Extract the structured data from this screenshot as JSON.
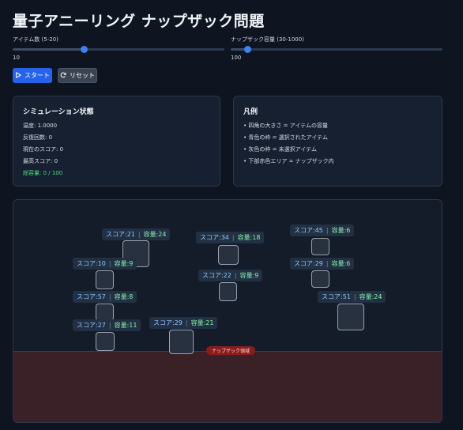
{
  "page_title": "量子アニーリング ナップザック問題",
  "controls": {
    "items_slider": {
      "label": "アイテム数 (5-20)",
      "value": "10",
      "level_fraction": 0.333
    },
    "capacity_slider": {
      "label": "ナップザック容量 (30-1000)",
      "value": "100",
      "level_fraction": 0.072
    },
    "start_label": "スタート",
    "reset_label": "リセット"
  },
  "status_panel": {
    "title": "シミュレーション状態",
    "temperature": "温度: 1.0000",
    "iterations": "反復回数: 0",
    "current_score": "現在のスコア: 0",
    "best_score": "最高スコア: 0",
    "total_capacity": "総容量: 0 / 100"
  },
  "legend_panel": {
    "title": "凡例",
    "items": [
      "• 四角の大きさ = アイテムの容量",
      "• 青色の枠 = 選択されたアイテム",
      "• 灰色の枠 = 未選択アイテム",
      "• 下部赤色エリア = ナップザック内"
    ]
  },
  "canvas": {
    "knapsack_label": "ナップザック領域",
    "items": [
      {
        "score": "スコア:21",
        "capacity": "容量:24"
      },
      {
        "score": "スコア:34",
        "capacity": "容量:18"
      },
      {
        "score": "スコア:45",
        "capacity": "容量:6"
      },
      {
        "score": "スコア:10",
        "capacity": "容量:9"
      },
      {
        "score": "スコア:29",
        "capacity": "容量:6"
      },
      {
        "score": "スコア:22",
        "capacity": "容量:9"
      },
      {
        "score": "スコア:57",
        "capacity": "容量:8"
      },
      {
        "score": "スコア:51",
        "capacity": "容量:24"
      },
      {
        "score": "スコア:27",
        "capacity": "容量:11"
      },
      {
        "score": "スコア:29",
        "capacity": "容量:21"
      }
    ]
  }
}
